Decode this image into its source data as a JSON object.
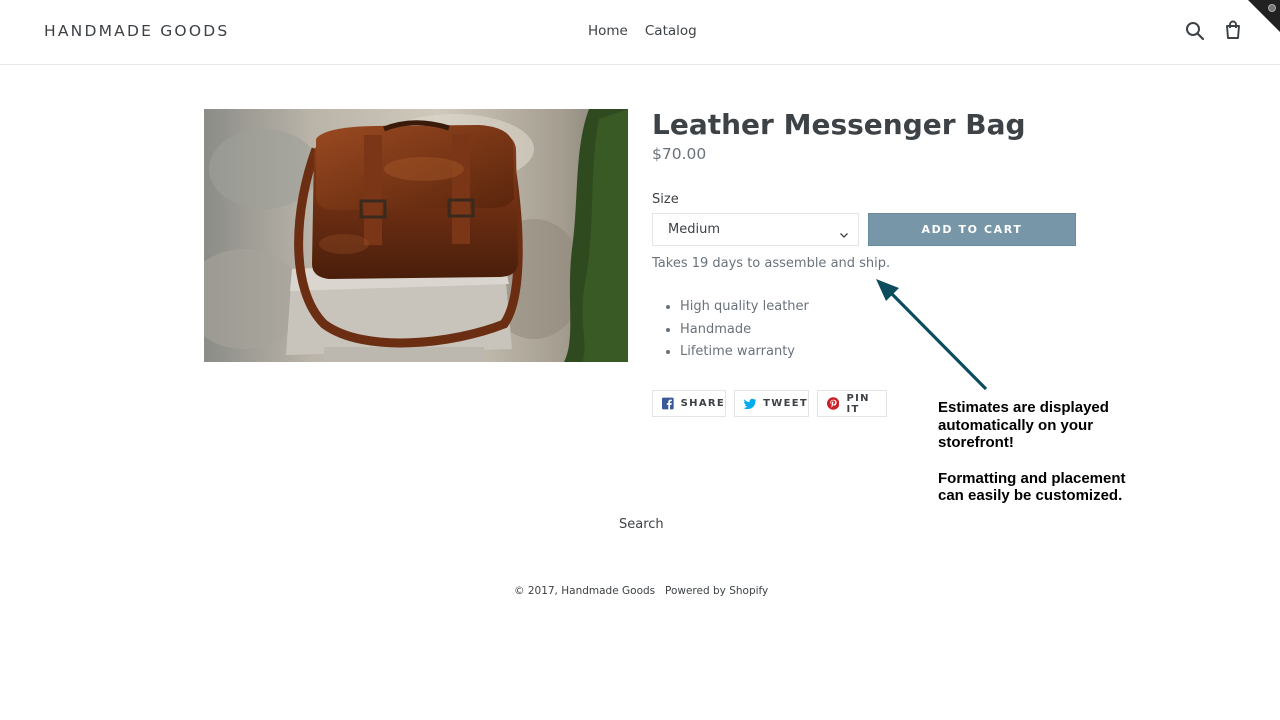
{
  "header": {
    "logo": "HANDMADE GOODS",
    "nav": [
      {
        "label": "Home"
      },
      {
        "label": "Catalog"
      }
    ],
    "icons": [
      "search-icon",
      "cart-icon"
    ]
  },
  "product": {
    "title": "Leather Messenger Bag",
    "price": "$70.00",
    "image_alt": "Leather Messenger Bag",
    "size_label": "Size",
    "size_selected": "Medium",
    "add_to_cart": "ADD TO CART",
    "estimate": "Takes 19 days to assemble and ship.",
    "features": [
      "High quality leather",
      "Handmade",
      "Lifetime warranty"
    ],
    "share": [
      {
        "label": "SHARE",
        "icon": "facebook-icon",
        "color": "#3b5998"
      },
      {
        "label": "TWEET",
        "icon": "twitter-icon",
        "color": "#00aced"
      },
      {
        "label": "PIN IT",
        "icon": "pinterest-icon",
        "color": "#cb2027"
      }
    ]
  },
  "annotation": {
    "line1": "Estimates are displayed",
    "line2": "automatically on your",
    "line3": "storefront!",
    "line4": "Formatting and placement",
    "line5": "can easily be customized.",
    "arrow_color": "#0b4c5f"
  },
  "footer": {
    "search": "Search",
    "copyright": "© 2017, Handmade Goods",
    "powered": "Powered by Shopify"
  },
  "colors": {
    "text": "#3d4246",
    "muted": "#69727b",
    "button": "#7796a8",
    "border": "#e8e9eb"
  }
}
